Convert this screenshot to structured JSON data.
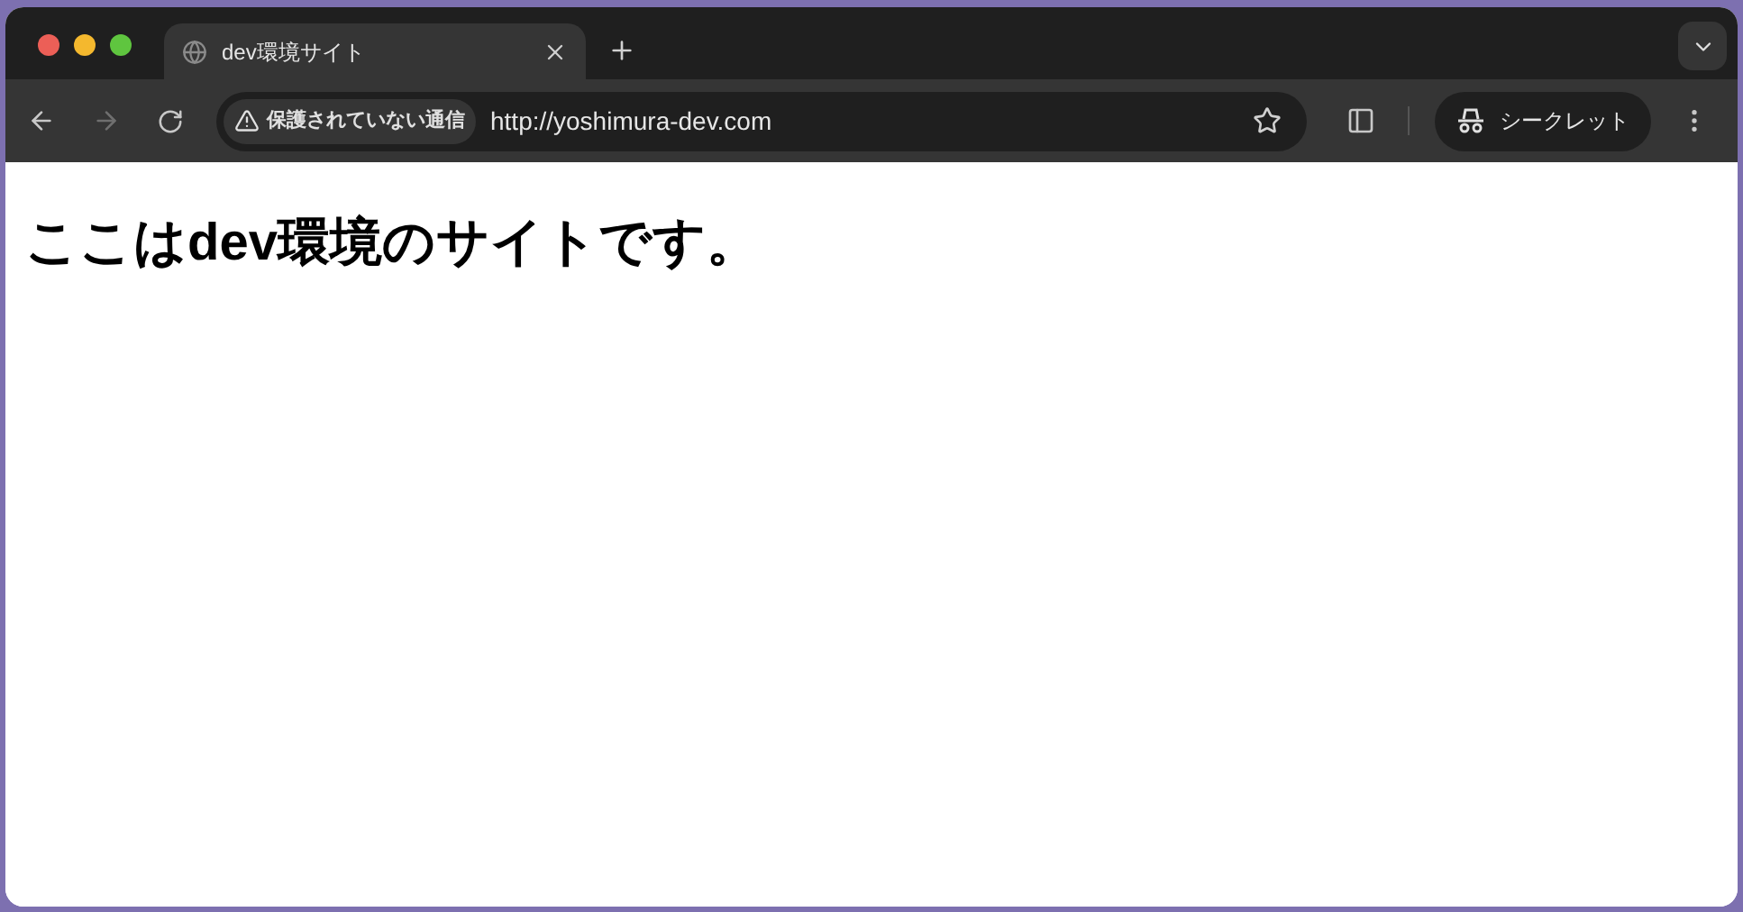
{
  "tabs": [
    {
      "title": "dev環境サイト",
      "selected": true
    }
  ],
  "toolbar": {
    "back": {
      "disabled": false
    },
    "forward": {
      "disabled": true
    },
    "security_chip": "保護されていない通信",
    "url": "http://yoshimura-dev.com",
    "incognito_label": "シークレット"
  },
  "page": {
    "heading": "ここはdev環境のサイトです。"
  }
}
